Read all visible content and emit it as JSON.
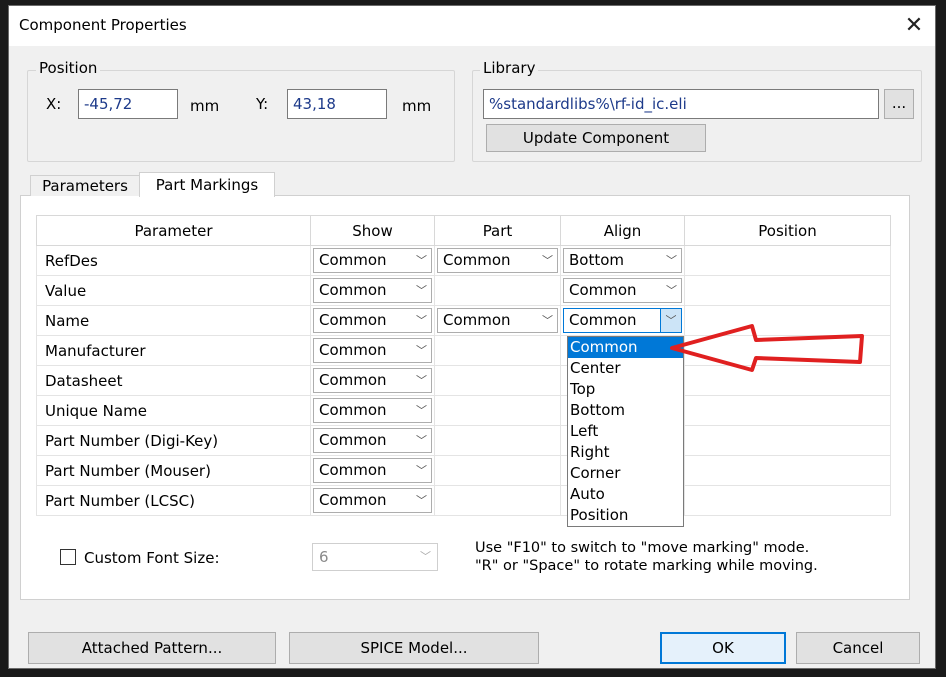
{
  "dialog": {
    "title": "Component Properties",
    "close": "✕"
  },
  "position": {
    "legend": "Position",
    "x_label": "X:",
    "x_value": "-45,72",
    "x_unit": "mm",
    "y_label": "Y:",
    "y_value": "43,18",
    "y_unit": "mm"
  },
  "library": {
    "legend": "Library",
    "path": "%standardlibs%\\rf-id_ic.eli",
    "browse": "...",
    "update": "Update Component"
  },
  "tabs": [
    "Parameters",
    "Part Markings"
  ],
  "grid": {
    "headers": [
      "Parameter",
      "Show",
      "Part",
      "Align",
      "Position"
    ],
    "rows": [
      {
        "param": "RefDes",
        "show": "Common",
        "part": "Common",
        "align": "Bottom"
      },
      {
        "param": "Value",
        "show": "Common",
        "part": "",
        "align": "Common"
      },
      {
        "param": "Name",
        "show": "Common",
        "part": "Common",
        "align": "Common"
      },
      {
        "param": "Manufacturer",
        "show": "Common",
        "part": "",
        "align": ""
      },
      {
        "param": "Datasheet",
        "show": "Common",
        "part": "",
        "align": ""
      },
      {
        "param": "Unique Name",
        "show": "Common",
        "part": "",
        "align": ""
      },
      {
        "param": "Part Number (Digi-Key)",
        "show": "Common",
        "part": "",
        "align": ""
      },
      {
        "param": "Part Number (Mouser)",
        "show": "Common",
        "part": "",
        "align": ""
      },
      {
        "param": "Part Number (LCSC)",
        "show": "Common",
        "part": "",
        "align": ""
      }
    ]
  },
  "align_dropdown": {
    "options": [
      "Common",
      "Center",
      "Top",
      "Bottom",
      "Left",
      "Right",
      "Corner",
      "Auto",
      "Position"
    ],
    "selected": "Common"
  },
  "font": {
    "label": "Custom Font Size:",
    "value": "6"
  },
  "hint": {
    "line1": "Use \"F10\" to switch to \"move marking\" mode.",
    "line2": "\"R\" or \"Space\" to rotate marking while moving."
  },
  "buttons": {
    "attached": "Attached Pattern...",
    "spice": "SPICE Model...",
    "ok": "OK",
    "cancel": "Cancel"
  },
  "icons": {
    "chevron": "chevron-down-icon",
    "annotation": "red-arrow-icon"
  },
  "colors": {
    "selection": "#0078d7",
    "arrow": "#e02020"
  }
}
